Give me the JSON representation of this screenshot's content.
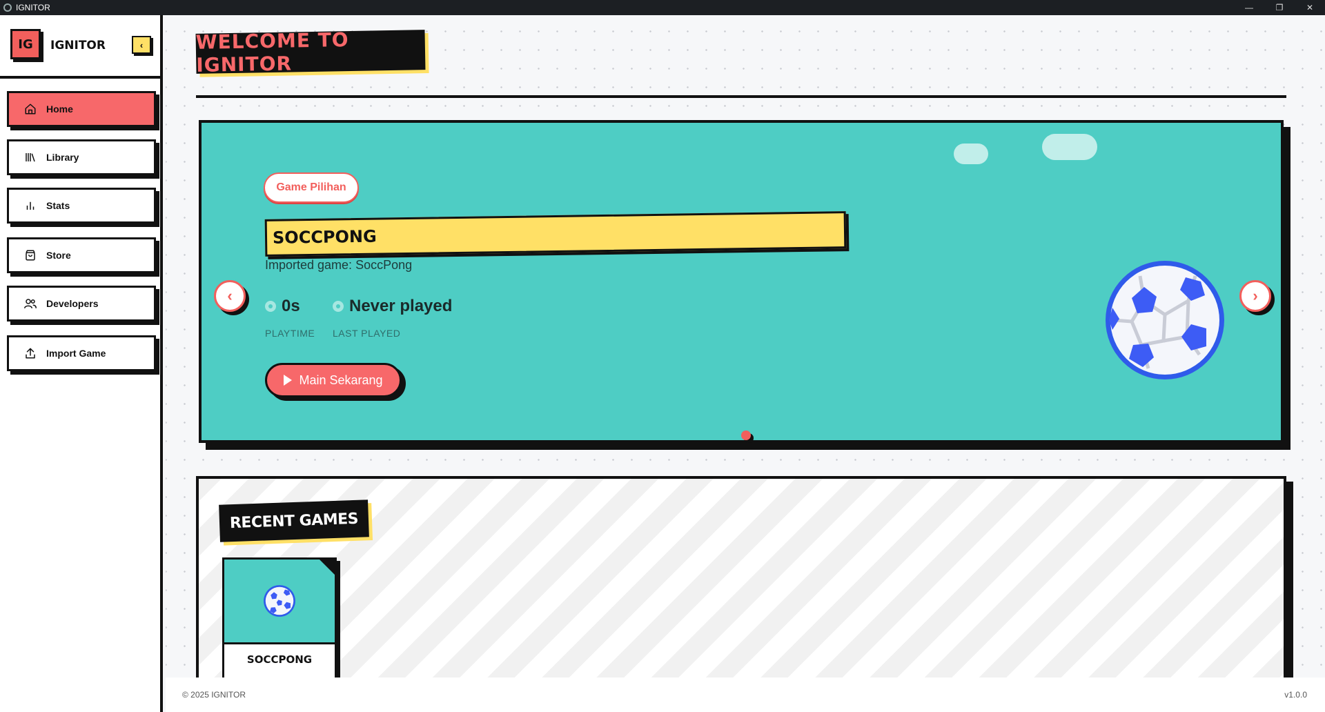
{
  "window": {
    "title": "IGNITOR",
    "controls": {
      "minimize": "—",
      "restore": "❐",
      "close": "✕"
    }
  },
  "sidebar": {
    "logo_text": "IG",
    "brand_name": "IGNITOR",
    "collapse_glyph": "‹",
    "items": [
      {
        "label": "Home",
        "icon": "home-icon",
        "active": true
      },
      {
        "label": "Library",
        "icon": "library-icon",
        "active": false
      },
      {
        "label": "Stats",
        "icon": "stats-icon",
        "active": false
      },
      {
        "label": "Store",
        "icon": "store-icon",
        "active": false
      },
      {
        "label": "Developers",
        "icon": "developers-icon",
        "active": false
      },
      {
        "label": "Import Game",
        "icon": "upload-icon",
        "active": false
      }
    ]
  },
  "main": {
    "welcome_title": "WELCOME TO IGNITOR",
    "hero": {
      "badge": "Game Pilihan",
      "title": "SOCCPONG",
      "description": "Imported game: SoccPong",
      "playtime_value": "0s",
      "playtime_label": "PLAYTIME",
      "last_played_value": "Never played",
      "last_played_label": "LAST PLAYED",
      "play_button": "Main Sekarang",
      "prev_glyph": "‹",
      "next_glyph": "›",
      "slide_index": 1,
      "slide_count": 1
    },
    "recent": {
      "title": "RECENT GAMES",
      "games": [
        {
          "title": "SOCCPONG",
          "icon": "soccer-ball-icon"
        }
      ]
    }
  },
  "footer": {
    "copyright": "© 2025 IGNITOR",
    "version": "v1.0.0"
  },
  "colors": {
    "accent_red": "#f7686a",
    "teal": "#4ecdc4",
    "yellow": "#ffe066",
    "ink": "#111111"
  }
}
